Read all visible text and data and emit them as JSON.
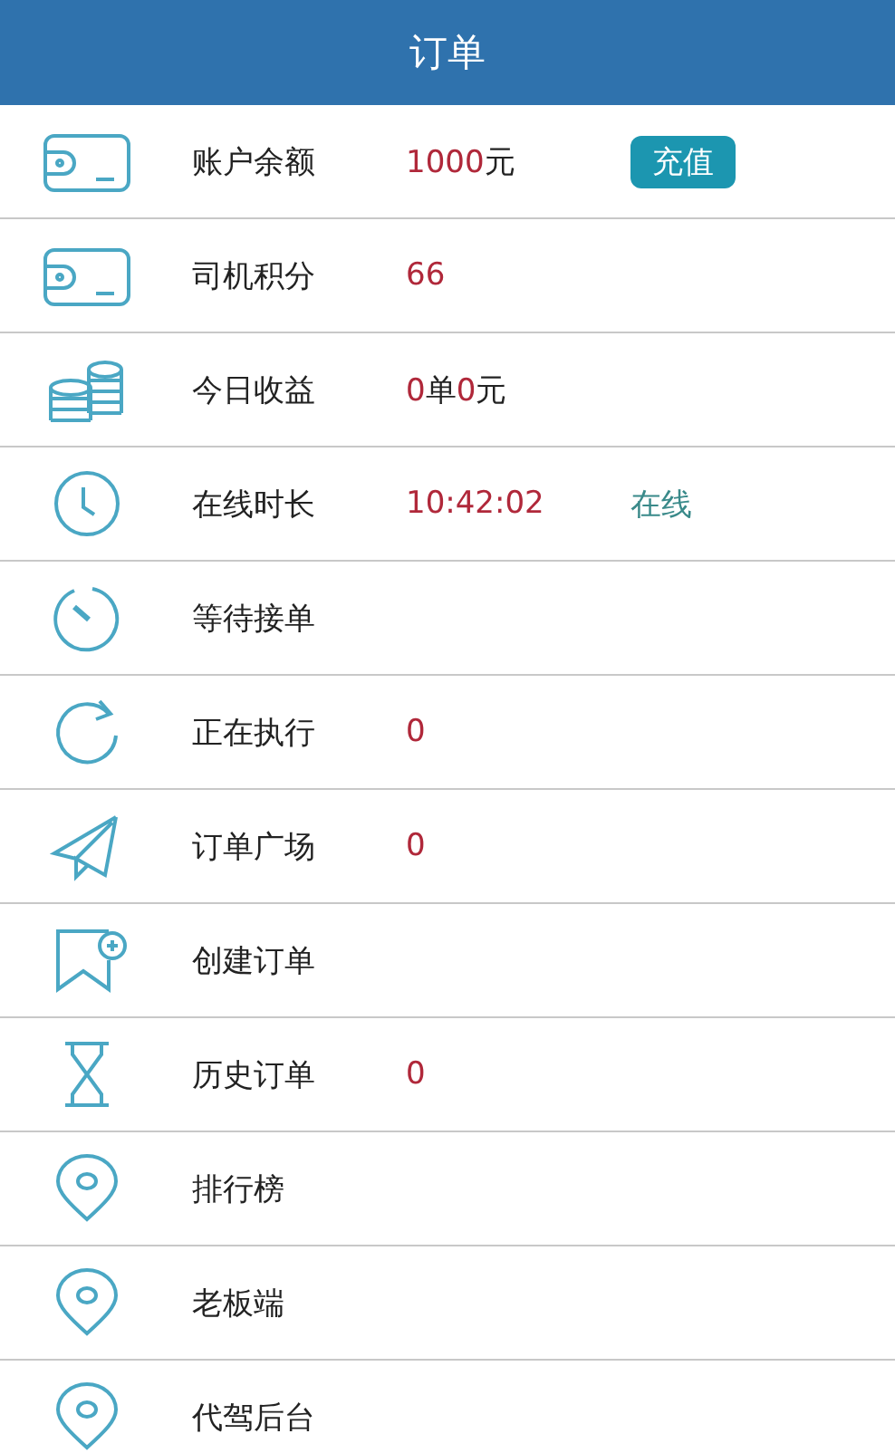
{
  "header": {
    "title": "订单"
  },
  "rows": [
    {
      "label": "账户余额",
      "value": [
        {
          "text": "1000",
          "kind": "num"
        },
        {
          "text": "元",
          "kind": "unit"
        }
      ],
      "button": "充值"
    },
    {
      "label": "司机积分",
      "value": [
        {
          "text": "66",
          "kind": "num"
        }
      ]
    },
    {
      "label": "今日收益",
      "value": [
        {
          "text": "0",
          "kind": "num"
        },
        {
          "text": "单",
          "kind": "unit"
        },
        {
          "text": "0",
          "kind": "num"
        },
        {
          "text": "元",
          "kind": "unit"
        }
      ]
    },
    {
      "label": "在线时长",
      "value": [
        {
          "text": "10:42:02",
          "kind": "num"
        }
      ],
      "status": "在线"
    },
    {
      "label": "等待接单"
    },
    {
      "label": "正在执行",
      "value": [
        {
          "text": "0",
          "kind": "num"
        }
      ]
    },
    {
      "label": "订单广场",
      "value": [
        {
          "text": "0",
          "kind": "num"
        }
      ]
    },
    {
      "label": "创建订单"
    },
    {
      "label": "历史订单",
      "value": [
        {
          "text": "0",
          "kind": "num"
        }
      ]
    },
    {
      "label": "排行榜"
    },
    {
      "label": "老板端"
    },
    {
      "label": "代驾后台"
    }
  ]
}
